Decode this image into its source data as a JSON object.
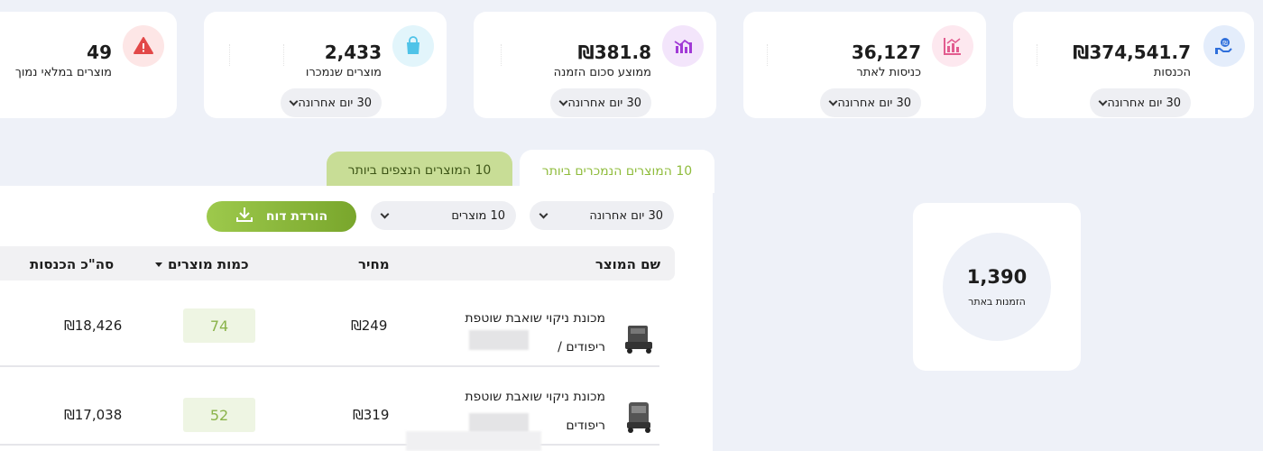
{
  "stats": {
    "revenue": {
      "value": "₪374,541.7",
      "label": "הכנסות",
      "range": "30 יום אחרונה",
      "icon": "hand-coin-icon",
      "color": "#2f6fdb"
    },
    "visits": {
      "value": "36,127",
      "label": "כניסות לאתר",
      "range": "30 יום אחרונה",
      "icon": "bar-chart-icon",
      "color": "#e25c8f"
    },
    "avg_order": {
      "value": "₪381.8",
      "label": "ממוצע סכום הזמנה",
      "range": "30 יום אחרונה",
      "icon": "trend-chart-icon",
      "color": "#a13ad6"
    },
    "sold": {
      "value": "2,433",
      "label": "מוצרים שנמכרו",
      "range": "30 יום אחרונה",
      "icon": "shopping-bag-icon",
      "color": "#4fc3e8"
    },
    "out_of_stock": {
      "value": "49",
      "label": "מוצרים במלאי נמוך",
      "icon": "warning-icon",
      "color": "#e24848"
    }
  },
  "orders": {
    "value": "1,390",
    "label": "הזמנות באתר"
  },
  "tabs": {
    "best_selling": "10 המוצרים הנמכרים ביותר",
    "most_viewed": "10 המוצרים הנצפים ביותר"
  },
  "filters": {
    "range": "30 יום אחרונה",
    "count": "10 מוצרים",
    "download": "הורדת דוח"
  },
  "table": {
    "headers": {
      "name": "שם המוצר",
      "price": "מחיר",
      "quantity": "כמות מוצרים",
      "revenue": "סה\"כ הכנסות"
    },
    "rows": [
      {
        "line1": "מכונת ניקוי שואבת שוטפת",
        "line2": "ריפודים / ",
        "price": "₪249",
        "quantity": "74",
        "revenue": "₪18,426"
      },
      {
        "line1": "מכונת ניקוי שואבת שוטפת",
        "line2": "ריפודים",
        "price": "₪319",
        "quantity": "52",
        "revenue": "₪17,038"
      }
    ]
  }
}
